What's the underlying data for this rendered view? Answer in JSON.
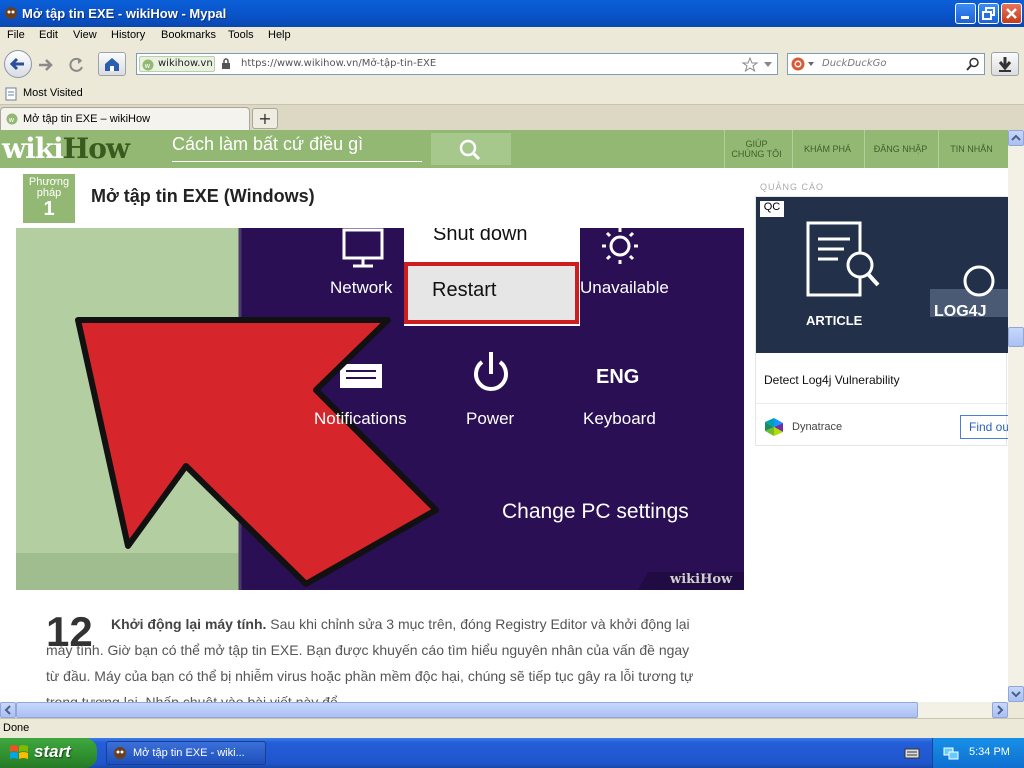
{
  "window": {
    "title": "Mở tập tin EXE - wikiHow - Mypal"
  },
  "menu": [
    "File",
    "Edit",
    "View",
    "History",
    "Bookmarks",
    "Tools",
    "Help"
  ],
  "toolbar": {
    "site_badge": "wikihow.vn",
    "url": "https://www.wikihow.vn/Mở-tập-tin-EXE",
    "search_placeholder": "DuckDuckGo"
  },
  "bookmarks": {
    "most_visited": "Most Visited"
  },
  "tab": {
    "label": "Mở tập tin EXE – wikiHow",
    "new_tab": "+"
  },
  "wikihow": {
    "logo_wiki": "wiki",
    "logo_how": "How",
    "search_placeholder": "Cách làm bất cứ điều gì",
    "nav": {
      "help_line1": "GIÚP",
      "help_line2": "CHÚNG TÔI",
      "explore": "KHÁM PHÁ",
      "login": "ĐĂNG NHẬP",
      "messages": "TIN NHẮN"
    }
  },
  "article": {
    "method_label_line1": "Phương",
    "method_label_line2": "pháp",
    "method_number": "1",
    "title": "Mở tập tin EXE (Windows)",
    "image": {
      "shutdown": "Shut down",
      "restart": "Restart",
      "network": "Network",
      "unavailable": "Unavailable",
      "notifications": "Notifications",
      "power": "Power",
      "keyboard_code": "ENG",
      "keyboard": "Keyboard",
      "change_pc": "Change PC settings",
      "watermark": "wikiHow"
    },
    "step_number": "12",
    "step_bold": "Khởi động lại máy tính.",
    "step_text": " Sau khi chỉnh sửa 3 mục trên, đóng Registry Editor và khởi động lại máy tính. Giờ bạn có thể mở tập tin EXE. Bạn được khuyến cáo tìm hiểu nguyên nhân của vấn đề ngay từ đầu. Máy của bạn có thể bị nhiễm virus hoặc phần mềm độc hại, chúng sẽ tiếp tục gây ra lỗi tương tự trong tương lai. Nhấp chuột vào bài viết này để"
  },
  "ad": {
    "label": "QUẢNG CÁO",
    "qc_badge": "QC",
    "article_tag": "ARTICLE",
    "brand_mark": "LOG4J",
    "headline": "Detect Log4j Vulnerability",
    "advertiser": "Dynatrace",
    "cta": "Find ou"
  },
  "status": {
    "text": "Done"
  },
  "taskbar": {
    "start": "start",
    "task_label": "Mở tập tin EXE - wiki...",
    "clock": "5:34 PM"
  },
  "colors": {
    "wikihow_green": "#93b874",
    "xp_blue": "#0a5fd8",
    "restart_highlight": "#cc1e1e",
    "arrow_red": "#d6252b",
    "screen_purple": "#2a0f55"
  }
}
